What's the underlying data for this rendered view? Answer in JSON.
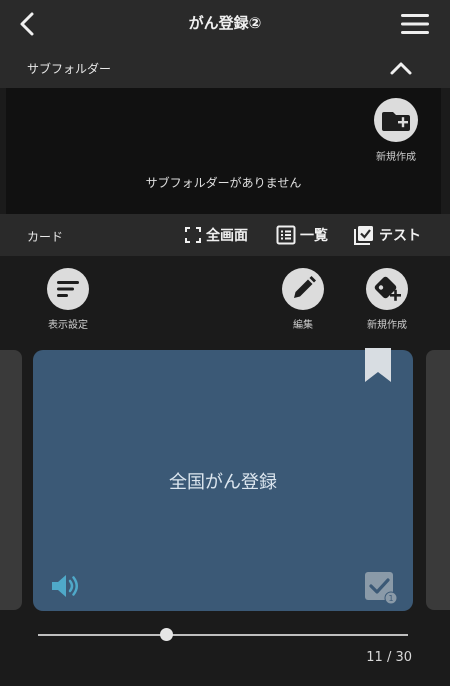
{
  "header": {
    "title": "がん登録②",
    "back_icon": "chevron-left-icon",
    "menu_icon": "hamburger-menu-icon"
  },
  "subfolder": {
    "label": "サブフォルダー",
    "collapse_icon": "chevron-up-icon",
    "new_button_label": "新規作成",
    "empty_message": "サブフォルダーがありません"
  },
  "card_section": {
    "label": "カード",
    "tools": {
      "fullscreen": "全画面",
      "list": "一覧",
      "test": "テスト"
    }
  },
  "card_tools": {
    "display_settings": "表示設定",
    "edit": "編集",
    "new": "新規作成"
  },
  "card": {
    "text": "全国がん登録",
    "check_count": "1",
    "background": "#3b5976"
  },
  "pager": {
    "counter": "11 / 30",
    "position": 11,
    "total": 30
  }
}
